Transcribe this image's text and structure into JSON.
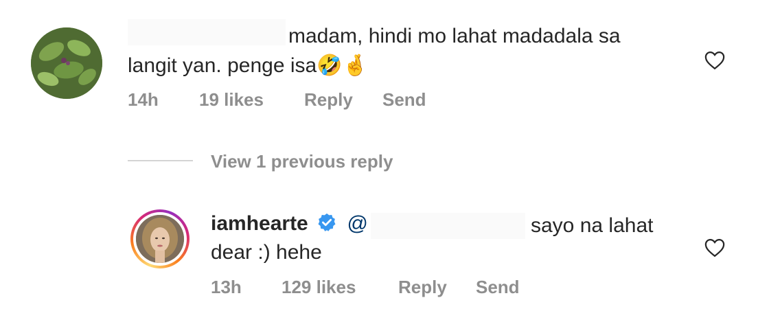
{
  "comment": {
    "text_line1": "madam, hindi mo lahat madadala sa",
    "text_line2": "langit yan. penge isa",
    "emojis": "🤣🤞",
    "time": "14h",
    "likes": "19 likes",
    "reply_label": "Reply",
    "send_label": "Send",
    "icon": "heart-outline-icon"
  },
  "view_replies": "View 1 previous reply",
  "reply": {
    "username": "iamhearte",
    "mention_prefix": "@",
    "text_after_mention": "sayo na lahat",
    "text_line2": "dear :) hehe",
    "time": "13h",
    "likes": "129 likes",
    "reply_label": "Reply",
    "send_label": "Send",
    "icon": "heart-outline-icon",
    "verified_color": "#3897f0"
  }
}
